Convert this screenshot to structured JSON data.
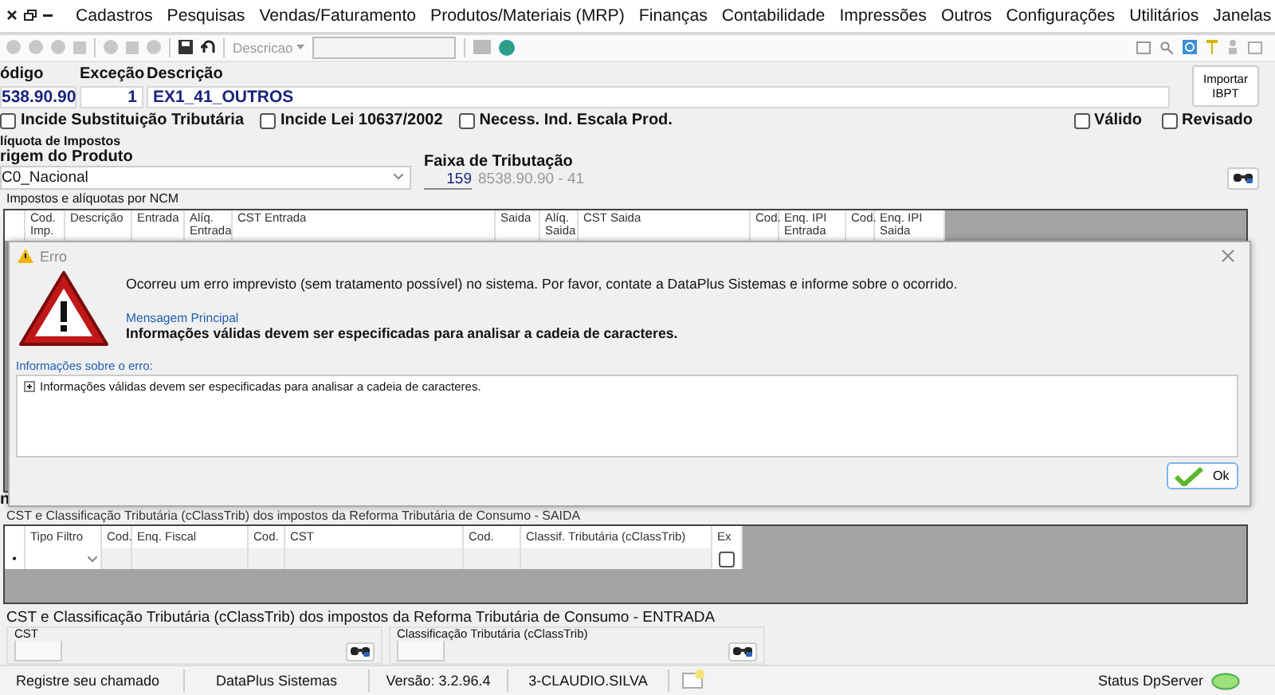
{
  "menu": {
    "items": [
      "Cadastros",
      "Pesquisas",
      "Vendas/Faturamento",
      "Produtos/Materiais (MRP)",
      "Finanças",
      "Contabilidade",
      "Impressões",
      "Outros",
      "Configurações",
      "Utilitários",
      "Janelas"
    ]
  },
  "toolbar": {
    "search_label": "Descricao"
  },
  "form": {
    "codigo_label": "ódigo",
    "codigo": "538.90.90",
    "excecao_label": "Exceção",
    "excecao": "1",
    "descricao_label": "Descrição",
    "descricao": "EX1_41_OUTROS",
    "import_button": "Importar IBPT"
  },
  "checkboxes": [
    {
      "label": "Incide Substituição Tributária",
      "checked": false
    },
    {
      "label": "Incide Lei 10637/2002",
      "checked": false
    },
    {
      "label": "Necess. Ind. Escala Prod.",
      "checked": false
    }
  ],
  "flags": [
    {
      "label": "Válido",
      "checked": false
    },
    {
      "label": "Revisado",
      "checked": false
    }
  ],
  "aliquota": {
    "title": "líquota de Impostos",
    "origem_label": "rigem do Produto",
    "origem": "C0_Nacional",
    "faixa_label": "Faixa de Tributação",
    "faixa_code": "159",
    "faixa_text": "8538.90.90 - 41"
  },
  "ncm_grid": {
    "title": "Impostos e alíquotas por NCM",
    "columns": [
      "Cod. Imp.",
      "Descrição",
      "Entrada",
      "Alíq. Entrada",
      "CST Entrada",
      "Saida",
      "Alíq. Saida",
      "CST Saida",
      "Cod.",
      "Enq. IPI Entrada",
      "Cod.",
      "Enq. IPI Saida"
    ]
  },
  "fragment": "n",
  "saida": {
    "title": "CST e Classificação Tributária (cClassTrib) dos impostos da Reforma Tributária de Consumo - SAIDA",
    "columns": [
      "Tipo Filtro",
      "Cod.",
      "Enq. Fiscal",
      "Cod.",
      "CST",
      "Cod.",
      "Classif. Tributária (cClassTrib)",
      "Ex"
    ],
    "row": {
      "marker": "•",
      "ex_checked": false
    }
  },
  "entrada": {
    "title": "CST e Classificação Tributária (cClassTrib) dos impostos da Reforma Tributária de Consumo - ENTRADA",
    "cst_label": "CST",
    "class_label": "Classificação Tributária (cClassTrib)"
  },
  "status_bar": {
    "items": [
      "Registre seu chamado",
      "DataPlus Sistemas",
      "Versão: 3.2.96.4",
      "3-CLAUDIO.SILVA"
    ],
    "server_label": "Status DpServer"
  },
  "dialog": {
    "title": "Erro",
    "message": "Ocorreu um erro imprevisto (sem tratamento possível) no sistema. Por favor, contate a DataPlus Sistemas e informe sobre o ocorrido.",
    "main_label": "Mensagem Principal",
    "main_message": "Informações válidas devem ser especificadas para analisar a cadeia de caracteres.",
    "details_label": "Informações sobre o erro:",
    "details": [
      {
        "text": "Informações válidas devem ser especificadas para analisar a cadeia de caracteres.",
        "expanded": false
      }
    ],
    "ok": "Ok"
  }
}
